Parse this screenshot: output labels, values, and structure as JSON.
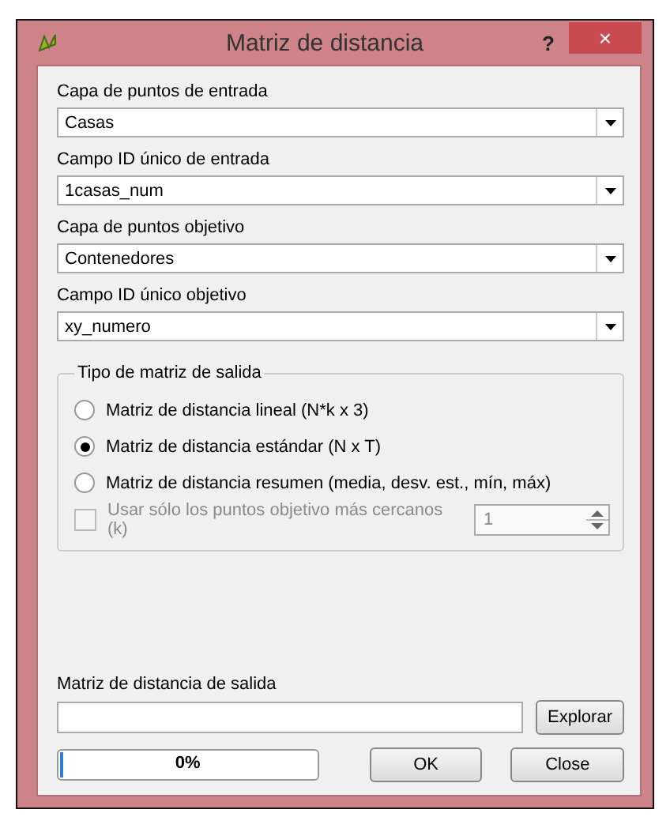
{
  "window": {
    "title": "Matriz de distancia",
    "help": "?",
    "close": "×"
  },
  "fields": [
    {
      "label": "Capa de puntos de entrada",
      "value": "Casas"
    },
    {
      "label": "Campo ID único de entrada",
      "value": "1casas_num"
    },
    {
      "label": "Capa de puntos objetivo",
      "value": "Contenedores"
    },
    {
      "label": "Campo ID único objetivo",
      "value": "xy_numero"
    }
  ],
  "output_type": {
    "title": "Tipo de matriz de salida",
    "options": [
      {
        "label": "Matriz de distancia lineal (N*k x 3)",
        "selected": false
      },
      {
        "label": "Matriz de distancia estándar (N x T)",
        "selected": true
      },
      {
        "label": "Matriz de distancia resumen (media, desv. est., mín, máx)",
        "selected": false
      }
    ],
    "nearest": {
      "label": "Usar sólo los puntos objetivo más cercanos (k)",
      "checked": false,
      "disabled": true,
      "value": "1"
    }
  },
  "output": {
    "label": "Matriz de distancia de salida",
    "browse": "Explorar"
  },
  "progress": {
    "level": 0.01,
    "text": "0%"
  },
  "buttons": [
    "OK",
    "Close"
  ]
}
